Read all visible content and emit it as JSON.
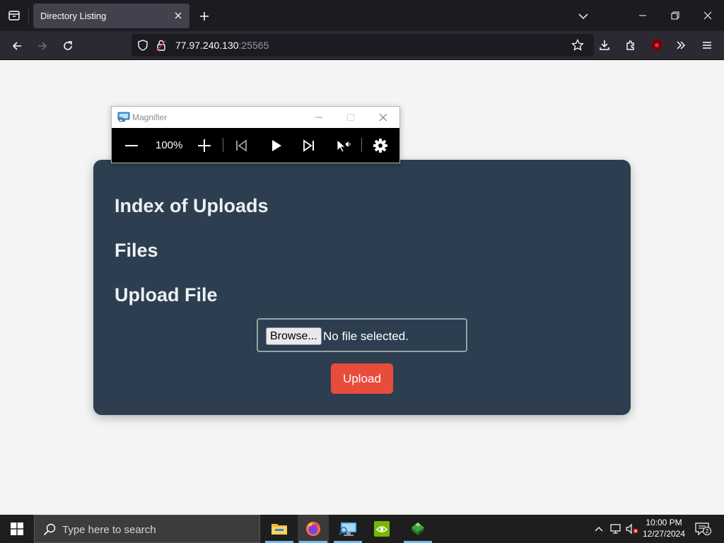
{
  "browser": {
    "tab_title": "Directory Listing",
    "url_host": "77.97.240.130",
    "url_port": ":25565"
  },
  "page": {
    "heading_index": "Index of Uploads",
    "heading_files": "Files",
    "heading_upload": "Upload File",
    "browse_label": "Browse...",
    "file_status": "No file selected.",
    "upload_label": "Upload",
    "colors": {
      "card": "#2c3e50",
      "upload_button": "#e74c3c",
      "heading_text": "#ecf0f1"
    }
  },
  "magnifier": {
    "title": "Magnifier",
    "zoom": "100%"
  },
  "taskbar": {
    "search_placeholder": "Type here to search",
    "time": "10:00 PM",
    "date": "12/27/2024",
    "notification_count": "2",
    "apps": [
      "file-explorer-icon",
      "firefox-icon",
      "remote-desktop-icon",
      "nvidia-icon",
      "app-icon"
    ]
  }
}
